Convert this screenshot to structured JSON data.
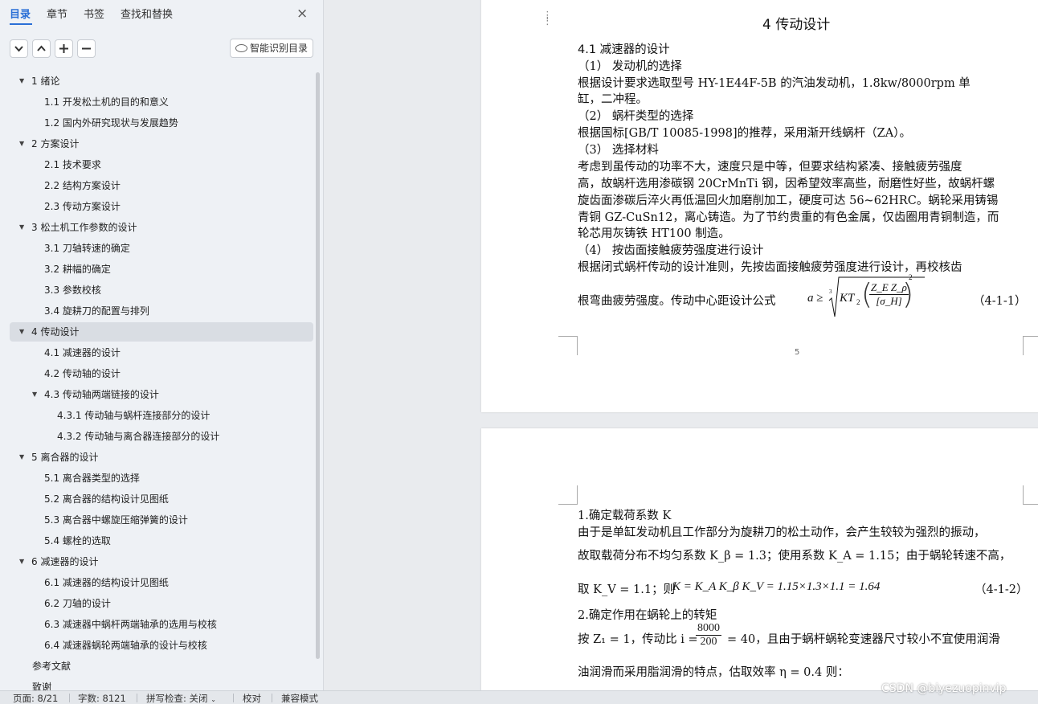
{
  "nav": {
    "tabs": [
      "目录",
      "章节",
      "书签",
      "查找和替换"
    ],
    "close": "×",
    "buttons": {
      "collapse": "⌄",
      "expand": "⌃",
      "add": "+",
      "remove": "−"
    },
    "smart_toc": "智能识别目录",
    "toc": [
      {
        "label": "1  绪论",
        "level": 1,
        "arrow": true
      },
      {
        "label": "1.1    开发松土机的目的和意义",
        "level": 2
      },
      {
        "label": "1.2    国内外研究现状与发展趋势",
        "level": 2
      },
      {
        "label": "2    方案设计",
        "level": 1,
        "arrow": true
      },
      {
        "label": "2.1    技术要求",
        "level": 2
      },
      {
        "label": "2.2    结构方案设计",
        "level": 2
      },
      {
        "label": "2.3    传动方案设计",
        "level": 2
      },
      {
        "label": "3  松土机工作参数的设计",
        "level": 1,
        "arrow": true
      },
      {
        "label": "3.1    刀轴转速的确定",
        "level": 2
      },
      {
        "label": "3.2    耕幅的确定",
        "level": 2
      },
      {
        "label": "3.3    参数校核",
        "level": 2
      },
      {
        "label": "3.4    旋耕刀的配置与排列",
        "level": 2
      },
      {
        "label": "4  传动设计",
        "level": 1,
        "arrow": true,
        "selected": true
      },
      {
        "label": "4.1    减速器的设计",
        "level": 2
      },
      {
        "label": "4.2    传动轴的设计",
        "level": 2
      },
      {
        "label": "4.3    传动轴两端链接的设计",
        "level": 2,
        "arrow": true
      },
      {
        "label": "4.3.1  传动轴与蜗杆连接部分的设计",
        "level": 3
      },
      {
        "label": "4.3.2 传动轴与离合器连接部分的设计",
        "level": 3
      },
      {
        "label": "5  离合器的设计",
        "level": 1,
        "arrow": true
      },
      {
        "label": "5.1    离合器类型的选择",
        "level": 2
      },
      {
        "label": "5.2    离合器的结构设计见图纸",
        "level": 2
      },
      {
        "label": "5.3    离合器中螺旋压缩弹簧的设计",
        "level": 2
      },
      {
        "label": "5.4    螺栓的选取",
        "level": 2
      },
      {
        "label": "6  减速器的设计",
        "level": 1,
        "arrow": true
      },
      {
        "label": "6.1  减速器的结构设计见图纸",
        "level": 2
      },
      {
        "label": "6.2  刀轴的设计",
        "level": 2
      },
      {
        "label": "6.3    减速器中蜗杆两端轴承的选用与校核",
        "level": 2
      },
      {
        "label": "6.4    减速器蜗轮两端轴承的设计与校核",
        "level": 2
      },
      {
        "label": "参考文献",
        "level": 0
      },
      {
        "label": "致谢",
        "level": 0
      }
    ]
  },
  "page1": {
    "heading": "4  传动设计",
    "lines": [
      "4.1   减速器的设计",
      "（1）  发动机的选择",
      "    根据设计要求选取型号 HY-1E44F-5B 的汽油发动机，1.8kw/8000rpm 单",
      "缸，二冲程。",
      "（2）  蜗杆类型的选择",
      "     根据国标[GB/T  10085-1998]的推荐，采用渐开线蜗杆（ZA）。",
      "（3）  选择材料",
      "   考虑到虽传动的功率不大，速度只是中等，但要求结构紧凑、接触疲劳强度",
      "高，故蜗杆选用渗碳钢 20CrMnTi 钢，因希望效率高些，耐磨性好些，故蜗杆螺",
      "旋齿面渗碳后淬火再低温回火加磨削加工，硬度可达 56~62HRC。蜗轮采用铸锡",
      "青铜 GZ-CuSn12，离心铸造。为了节约贵重的有色金属，仅齿圈用青铜制造，而",
      "轮芯用灰铸铁 HT100 制造。",
      "（4）  按齿面接触疲劳强度进行设计",
      "    根据闭式蜗杆传动的设计准则，先按齿面接触疲劳强度进行设计，再校核齿"
    ],
    "formula_lead": "根弯曲疲劳强度。传动中心距设计公式",
    "formula_left": "a ≥",
    "formula_root_index": "3",
    "formula_kt": "KT",
    "formula_kt_sub": "2",
    "formula_num": "Z_E Z_ρ",
    "formula_den": "[σ_H]",
    "formula_exp": "2",
    "formula_tag": "（4-1-1）",
    "page_number": "5"
  },
  "page2": {
    "lines": [
      "    1.确定载荷系数 K",
      "由于是单缸发动机且工作部分为旋耕刀的松土动作，会产生较较为强烈的振动，"
    ],
    "line3": "故取载荷分布不均匀系数 K_β = 1.3；使用系数 K_A = 1.15；由于蜗轮转速不高，",
    "line4_lead": "取 K_V = 1.1；则",
    "line4_formula": "K = K_A K_β K_V = 1.15×1.3×1.1 = 1.64",
    "line4_tag": "（4-1-2）",
    "line5": "    2.确定作用在蜗轮上的转矩",
    "line6_lead": "按 Z₁ = 1，传动比 i =",
    "line6_num": "8000",
    "line6_den": "200",
    "line6_tail": "= 40，且由于蜗杆蜗轮变速器尺寸较小不宜使用润滑",
    "line7": "油润滑而采用脂润滑的特点，估取效率 η = 0.4 则："
  },
  "status": {
    "page": "页面: 8/21",
    "words": "字数: 8121",
    "spell": "拼写检查: 关闭",
    "proof": "校对",
    "compat": "兼容模式"
  },
  "watermark": "CSDN @biyezuopinvip"
}
